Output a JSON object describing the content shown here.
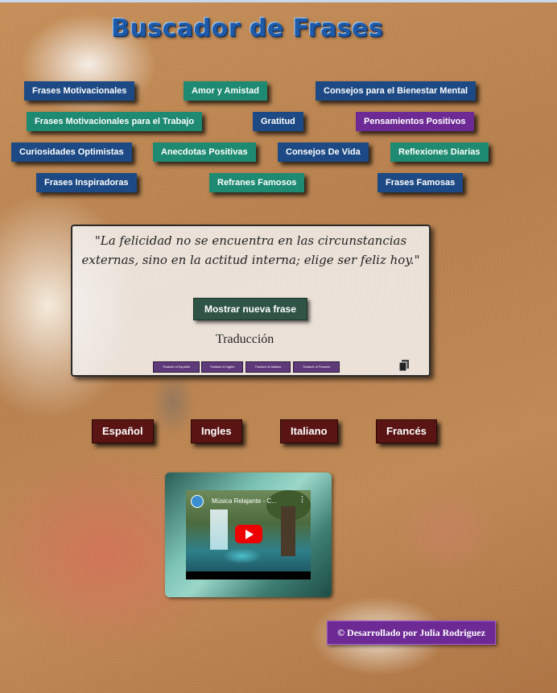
{
  "app": {
    "title": "Buscador de Frases"
  },
  "categories": [
    {
      "label": "Frases Motivacionales",
      "color": "#1d4a84"
    },
    {
      "label": "Amor y Amistad",
      "color": "#1e8a72"
    },
    {
      "label": "Consejos para el Bienestar Mental",
      "color": "#1d4a84"
    },
    {
      "label": "Frases Motivacionales para el Trabajo",
      "color": "#1e8a72"
    },
    {
      "label": "Gratitud",
      "color": "#1d4a84"
    },
    {
      "label": "Pensamientos Positivos",
      "color": "#6d2a95"
    },
    {
      "label": "Curiosidades Optimistas",
      "color": "#1d4a84"
    },
    {
      "label": "Anecdotas Positivas",
      "color": "#1e8a72"
    },
    {
      "label": "Consejos De Vida",
      "color": "#1d4a84"
    },
    {
      "label": "Reflexiones Diarias",
      "color": "#1e8a72"
    },
    {
      "label": "Frases Inspiradoras",
      "color": "#1d4a84"
    },
    {
      "label": "Refranes Famosos",
      "color": "#1e8a72"
    },
    {
      "label": "Frases Famosas",
      "color": "#1d4a84"
    }
  ],
  "quote": {
    "text": "\"La felicidad no se encuentra en las circunstancias externas, sino en la actitud interna; elige ser feliz hoy.\"",
    "new_button": "Mostrar nueva frase",
    "translation_label": "Traducción",
    "mini_buttons": [
      "Traducir al Español",
      "Traducir al Inglés",
      "Traducir al Italiano",
      "Traducir al Francés"
    ],
    "copy_icon": "copy-icon"
  },
  "languages": [
    "Español",
    "Ingles",
    "Italiano",
    "Francés"
  ],
  "video": {
    "title": "Música Relajante - C...",
    "menu": "⋮"
  },
  "footer": {
    "text": "© Desarrollado por Julia Rodriguez"
  }
}
